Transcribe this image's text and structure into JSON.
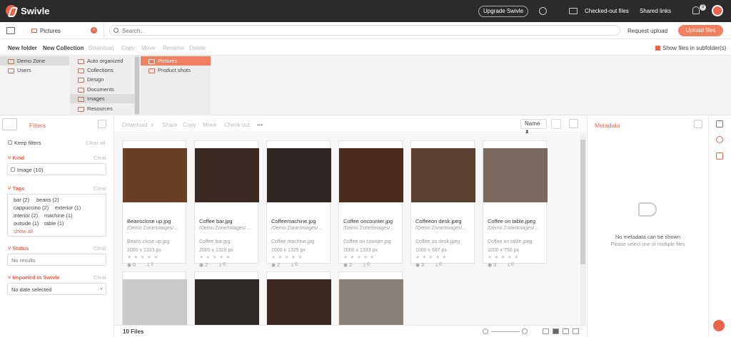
{
  "header": {
    "brand": "Swivle",
    "upgrade": "Upgrade Swivle",
    "checked_out": "Checked-out files",
    "shared_links": "Shared links",
    "notifications": "3",
    "icons": {
      "globe": "globe-icon",
      "monitor": "monitor-icon",
      "bell": "bell-icon"
    }
  },
  "location": {
    "value": "Pictures"
  },
  "search": {
    "placeholder": "Search..."
  },
  "actions": {
    "request_upload": "Request upload",
    "upload_files": "Upload files"
  },
  "toolbar": {
    "new_folder": "New folder",
    "new_collection": "New Collection",
    "download": "Download",
    "copy": "Copy",
    "move": "Move",
    "rename": "Rename",
    "delete": "Delete",
    "show_subfolders": "Show files in subfolder(s)"
  },
  "tree": {
    "col1": [
      "Demo Zone",
      "Users"
    ],
    "col2": [
      "Auto organized",
      "Collections",
      "Design",
      "Documents",
      "Images",
      "Resources"
    ],
    "col3": [
      "Pictures",
      "Product shots"
    ]
  },
  "filters": {
    "title": "Filters",
    "keep_filters": "Keep filters",
    "clear_all": "Clear all",
    "clear": "Clear",
    "kind": {
      "label": "Kind",
      "option": "Image (10)"
    },
    "tags": {
      "label": "Tags",
      "rows": [
        [
          "bar (2)",
          "beans (2)"
        ],
        [
          "cappuccino (2)",
          "exterior (1)"
        ],
        [
          "interior (2)",
          "machine (1)"
        ],
        [
          "outside (1)",
          "table (1)"
        ]
      ],
      "show_all": "show all"
    },
    "status": {
      "label": "Status",
      "value": "No results"
    },
    "imported": {
      "label": "Imported in Swivle",
      "value": "No date selected"
    }
  },
  "file_toolbar": {
    "download": "Download",
    "share": "Share",
    "copy": "Copy",
    "move": "Move",
    "check_out": "Check out",
    "more": "•••",
    "sort": "Name"
  },
  "files": [
    {
      "name": "Beansclose up.jpg",
      "path": "/Demo Zone/Images/...",
      "title": "Beans close up.jpg",
      "dims": "2000 x 1333 px",
      "views": "0",
      "downloads": "1",
      "color": "#6b3f24"
    },
    {
      "name": "Coffee bar.jpg",
      "path": "/Demo Zone/Images/...",
      "title": "Coffee bar.jpg",
      "dims": "2000 x 1328 px",
      "views": "2",
      "downloads": "0",
      "color": "#3a2a22"
    },
    {
      "name": "Coffeemachine.jpg",
      "path": "/Demo Zone/Images/...",
      "title": "Coffee machine.jpg",
      "dims": "2000 x 1325 px",
      "views": "2",
      "downloads": "0",
      "color": "#2e2622"
    },
    {
      "name": "Coffee oncounter.jpg",
      "path": "/Demo Zone/Images/...",
      "title": "Coffee on counter.jpg",
      "dims": "2000 x 1333 px",
      "views": "2",
      "downloads": "0",
      "color": "#4a2c1c"
    },
    {
      "name": "Coffeeon desk.jpeg",
      "path": "/Demo Zone/Images/...",
      "title": "Coffee on desk.jpeg",
      "dims": "1000 x 667 px",
      "views": "3",
      "downloads": "0",
      "color": "#5a4030"
    },
    {
      "name": "Coffee on table.jpeg",
      "path": "/Demo Zone/Images/...",
      "title": "Coffee on table.jpeg",
      "dims": "1000 x 750 px",
      "views": "3",
      "downloads": "0",
      "color": "#7a6a5e"
    }
  ],
  "files_row2": [
    {
      "color": "#c9c9c9"
    },
    {
      "color": "#2f2a28"
    },
    {
      "color": "#3b2a1f"
    },
    {
      "color": "#8a8078"
    }
  ],
  "file_count": "10 Files",
  "metadata": {
    "title": "Metadata",
    "none": "No metadata can be shown",
    "hint": "Please select one or multiple files"
  }
}
